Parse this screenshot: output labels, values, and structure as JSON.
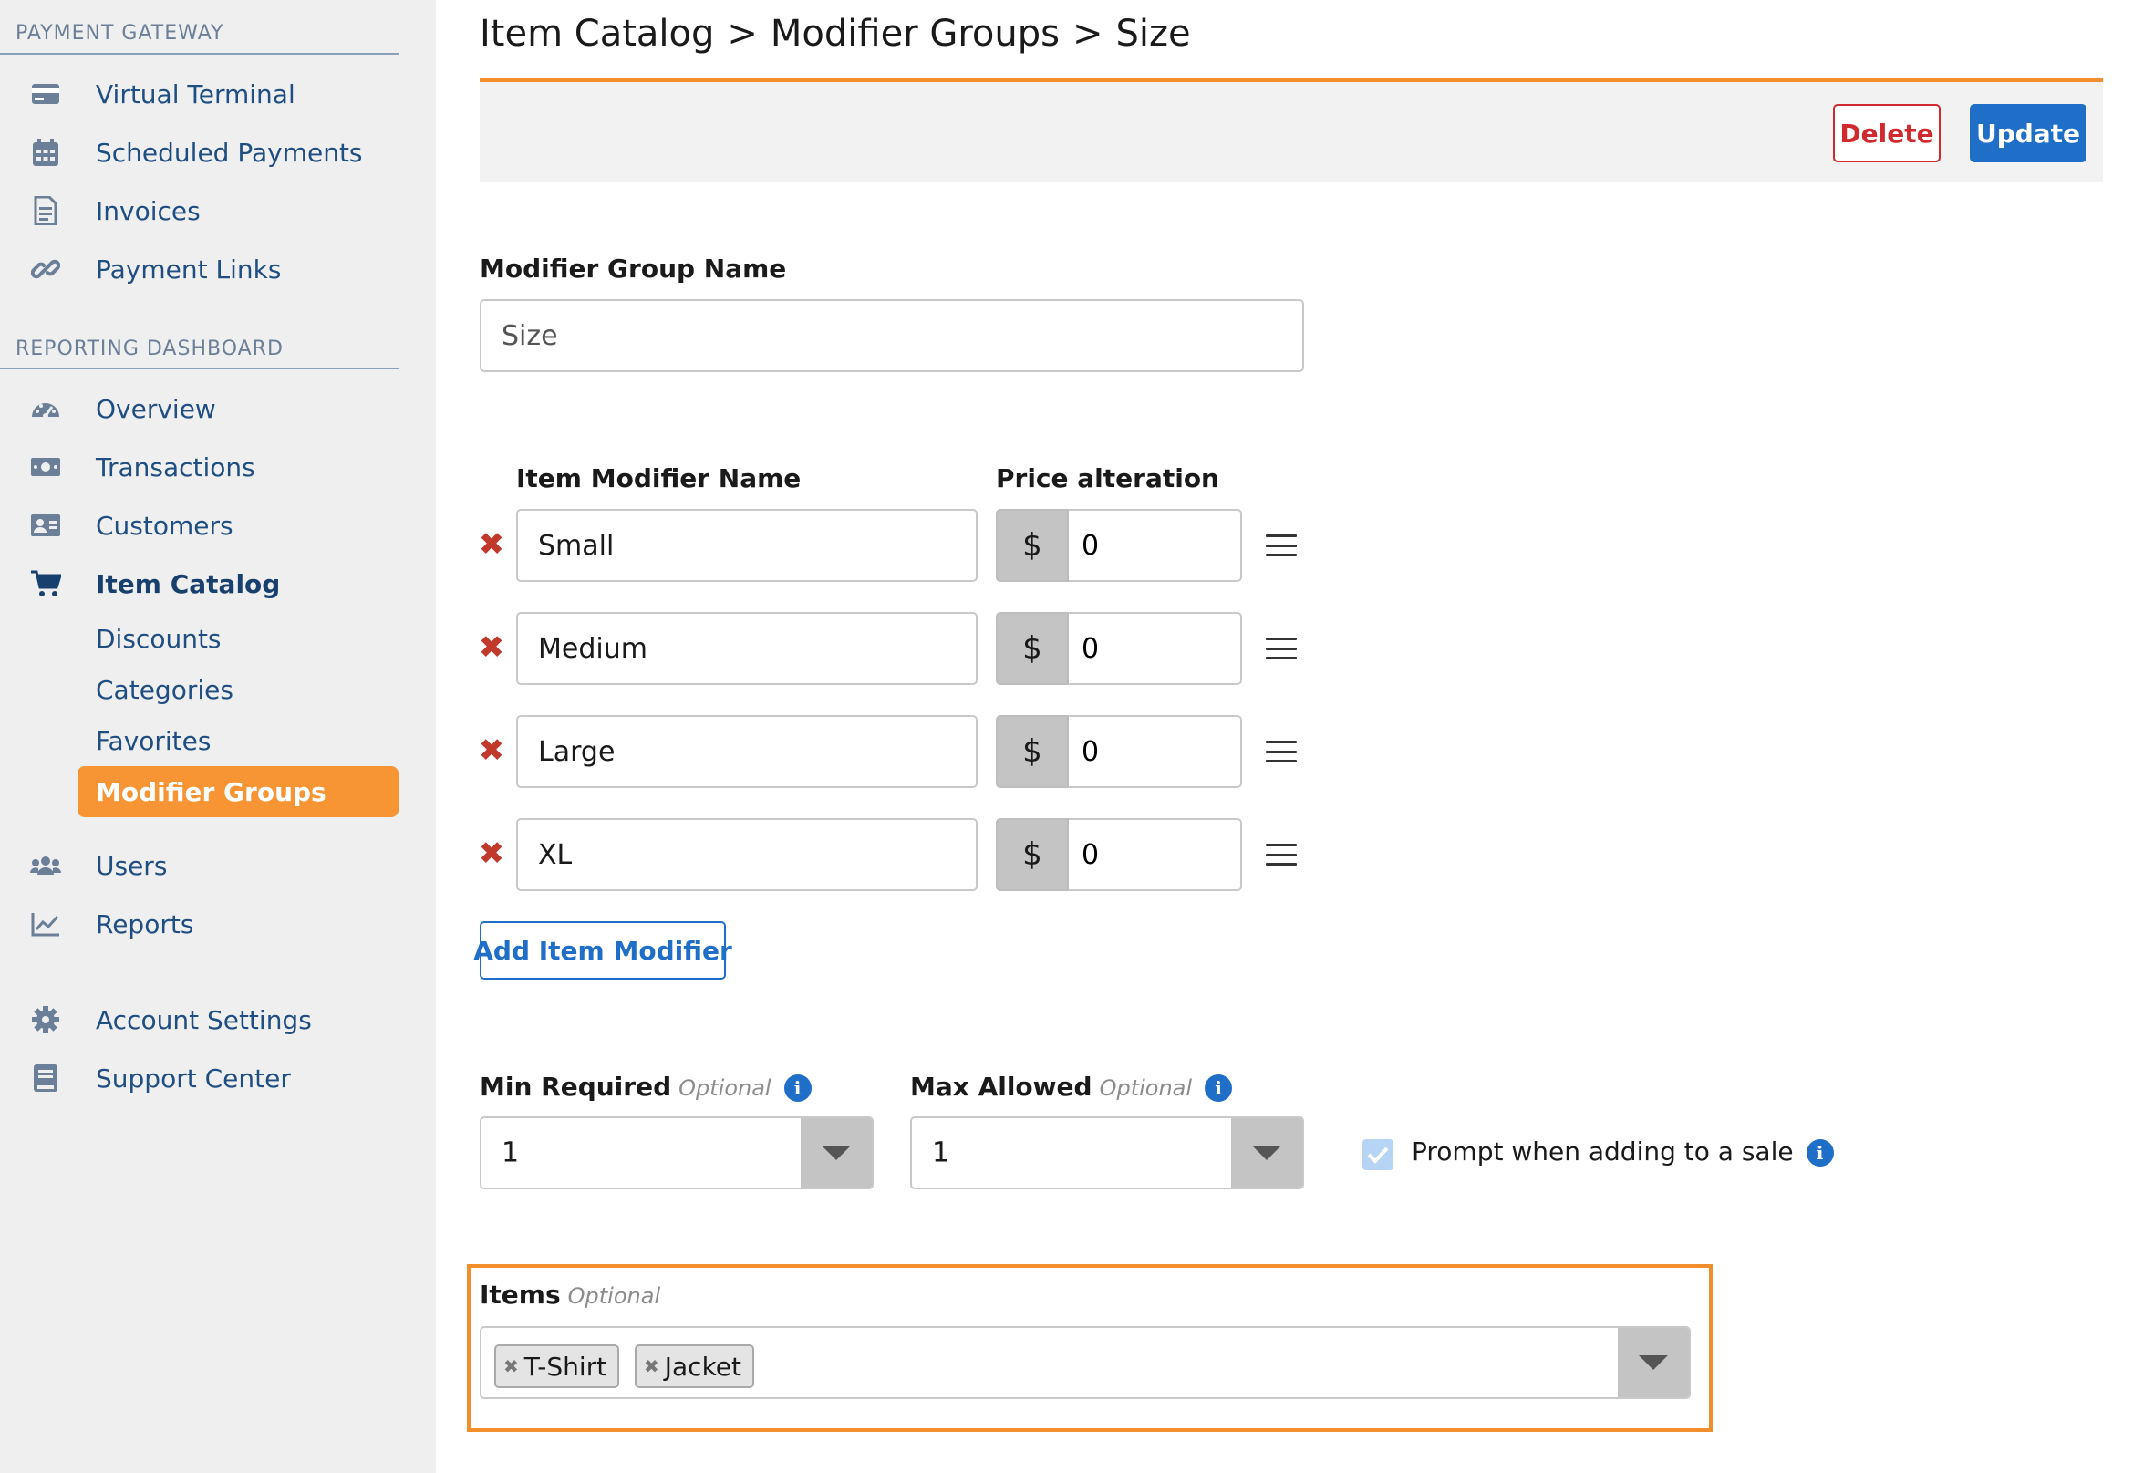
{
  "sidebar": {
    "section_payment": "PAYMENT GATEWAY",
    "section_reporting": "REPORTING DASHBOARD",
    "payment_items": [
      {
        "label": "Virtual Terminal",
        "icon": "credit-card-icon"
      },
      {
        "label": "Scheduled Payments",
        "icon": "calendar-icon"
      },
      {
        "label": "Invoices",
        "icon": "invoice-icon"
      },
      {
        "label": "Payment Links",
        "icon": "link-icon"
      }
    ],
    "reporting_items": [
      {
        "label": "Overview",
        "icon": "dashboard-gauge-icon"
      },
      {
        "label": "Transactions",
        "icon": "money-icon"
      },
      {
        "label": "Customers",
        "icon": "address-card-icon"
      },
      {
        "label": "Item Catalog",
        "icon": "shopping-cart-icon"
      }
    ],
    "catalog_subitems": [
      "Discounts",
      "Categories",
      "Favorites",
      "Modifier Groups"
    ],
    "more_items": [
      {
        "label": "Users",
        "icon": "users-icon"
      },
      {
        "label": "Reports",
        "icon": "chart-line-icon"
      }
    ],
    "bottom_items": [
      {
        "label": "Account Settings",
        "icon": "gear-icon"
      },
      {
        "label": "Support Center",
        "icon": "book-icon"
      }
    ]
  },
  "breadcrumb": {
    "parts": [
      "Item Catalog",
      "Modifier Groups",
      "Size"
    ],
    "separator": ">"
  },
  "toolbar": {
    "delete_label": "Delete",
    "update_label": "Update"
  },
  "form": {
    "group_name_label": "Modifier Group Name",
    "group_name_value": "Size",
    "modifier_name_header": "Item Modifier Name",
    "price_header": "Price alteration",
    "currency_symbol": "$",
    "modifiers": [
      {
        "name": "Small",
        "price": "0"
      },
      {
        "name": "Medium",
        "price": "0"
      },
      {
        "name": "Large",
        "price": "0"
      },
      {
        "name": "XL",
        "price": "0"
      }
    ],
    "add_modifier_label": "Add Item Modifier",
    "min_label": "Min Required",
    "max_label": "Max Allowed",
    "optional_text": "Optional",
    "min_value": "1",
    "max_value": "1",
    "prompt_label": "Prompt when adding to a sale",
    "prompt_checked": true,
    "items_label": "Items",
    "items_tags": [
      "T-Shirt",
      "Jacket"
    ]
  },
  "colors": {
    "accent_orange": "#f28e2b",
    "primary_blue": "#1f6fc9",
    "danger_red": "#d0292e",
    "nav_text": "#1f4e83"
  }
}
